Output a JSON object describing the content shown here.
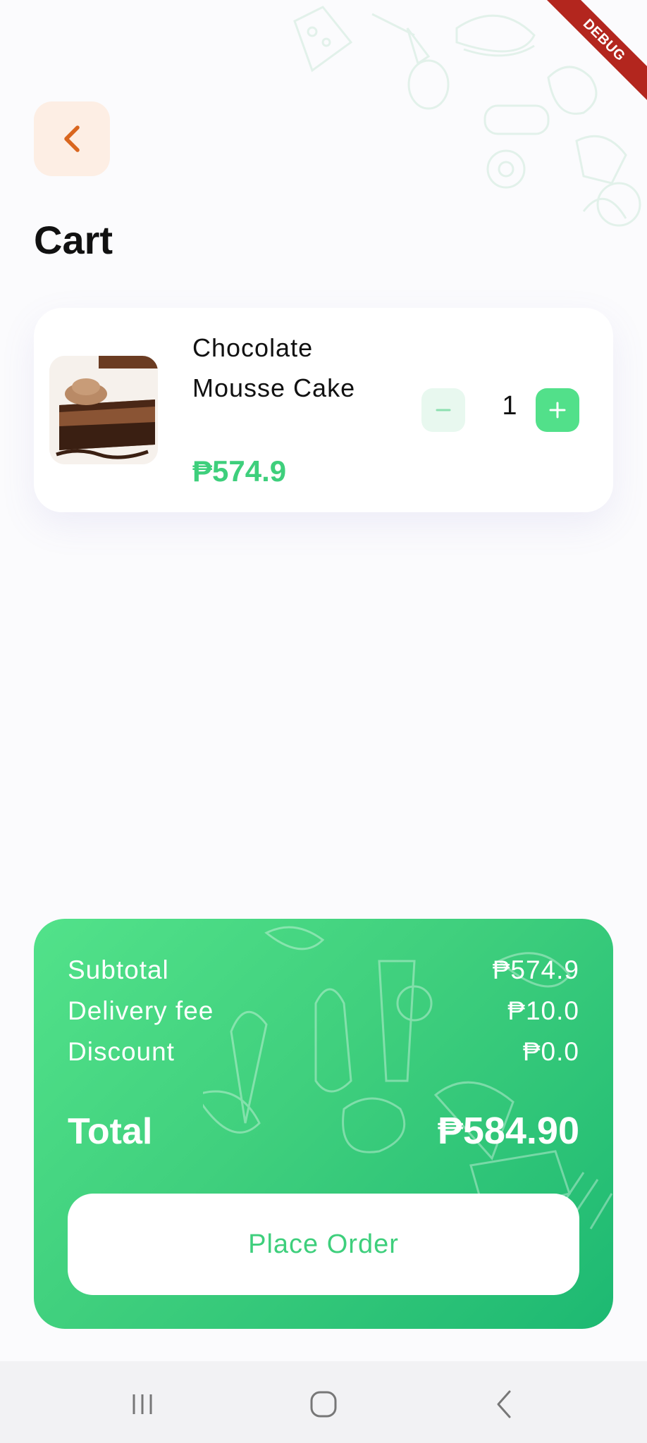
{
  "debug_banner": "DEBUG",
  "header": {
    "title": "Cart"
  },
  "cart": {
    "items": [
      {
        "name": "Chocolate Mousse Cake",
        "price": "₱574.9",
        "quantity": "1"
      }
    ]
  },
  "summary": {
    "subtotal_label": "Subtotal",
    "subtotal_value": "₱574.9",
    "delivery_label": "Delivery fee",
    "delivery_value": "₱10.0",
    "discount_label": "Discount",
    "discount_value": "₱0.0",
    "total_label": "Total",
    "total_value": "₱584.90",
    "place_order_label": "Place Order"
  },
  "icons": {
    "back": "chevron-left-icon",
    "minus": "minus-icon",
    "plus": "plus-icon",
    "nav_recents": "recents-icon",
    "nav_home": "home-icon",
    "nav_back": "back-icon"
  },
  "colors": {
    "accent_green": "#3ecf7c",
    "back_button_bg": "#fdeee4",
    "back_chevron": "#d9661f",
    "debug_red": "#b3261e"
  }
}
